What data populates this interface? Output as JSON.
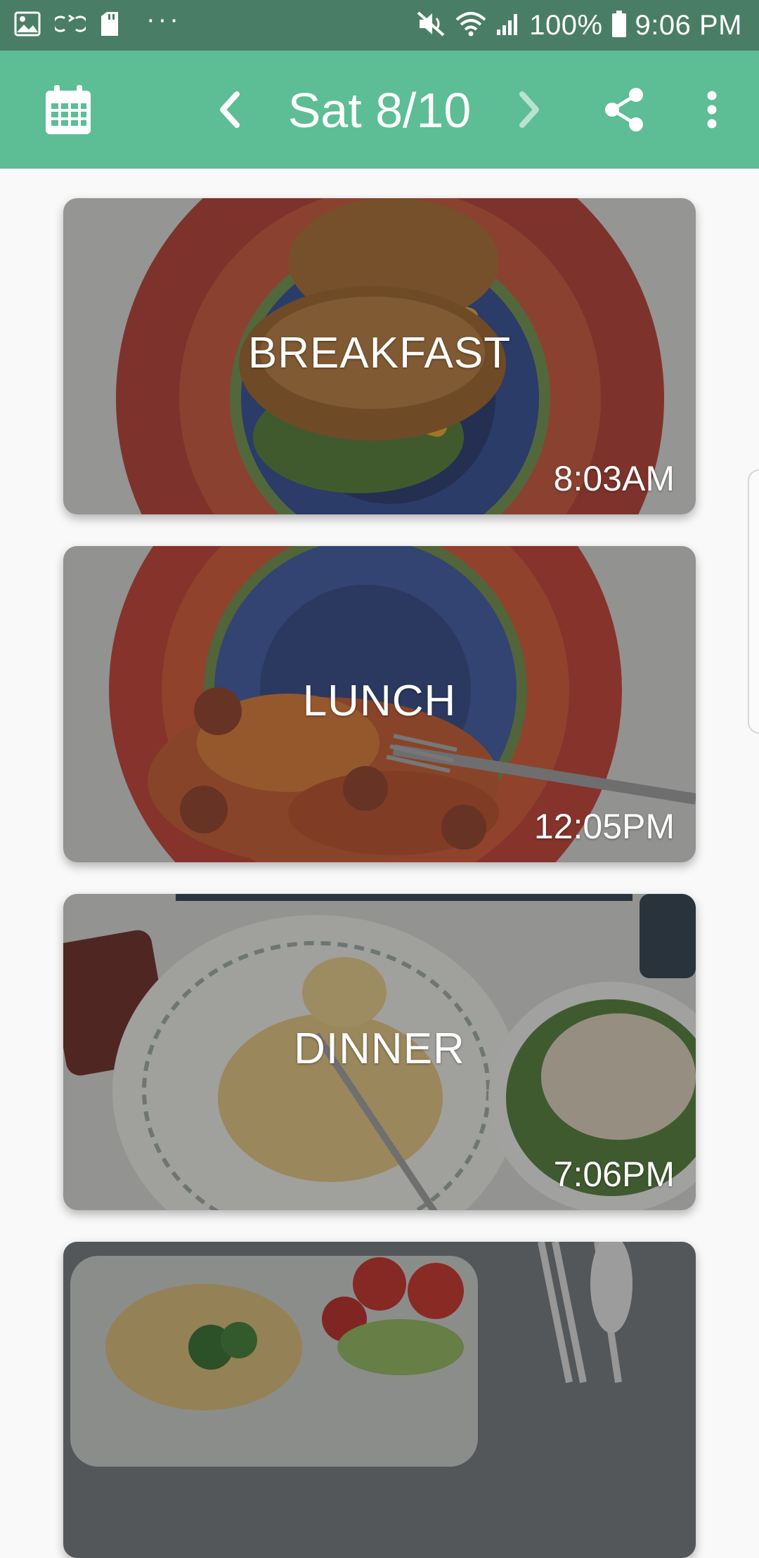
{
  "status_bar": {
    "battery": "100%",
    "time": "9:06 PM",
    "left_icons": [
      "gallery-icon",
      "sync-icon",
      "sd-card-icon",
      "more-notifications-icon"
    ],
    "right_icons": [
      "mute-icon",
      "wifi-icon",
      "signal-icon",
      "battery-icon"
    ]
  },
  "app_bar": {
    "date": "Sat 8/10",
    "icons": [
      "calendar-icon",
      "chevron-left-icon",
      "chevron-right-icon",
      "share-icon",
      "more-vert-icon"
    ]
  },
  "meals": [
    {
      "name": "BREAKFAST",
      "time": "8:03AM"
    },
    {
      "name": "LUNCH",
      "time": "12:05PM"
    },
    {
      "name": "DINNER",
      "time": "7:06PM"
    },
    {
      "name": "",
      "time": ""
    }
  ],
  "colors": {
    "status_bar": "#4a7d66",
    "app_bar": "#5dbd95",
    "background": "#f9f9f9"
  }
}
